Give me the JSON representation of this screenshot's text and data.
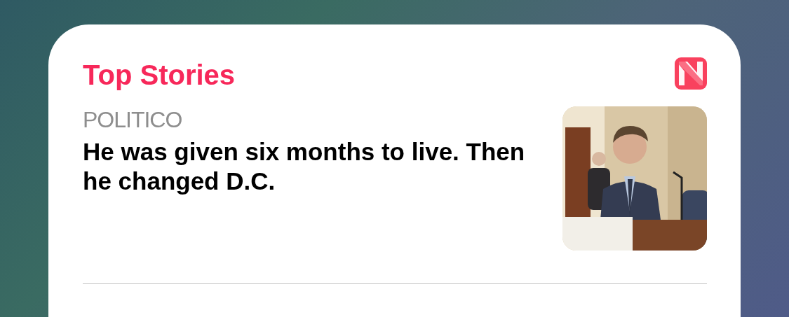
{
  "widget": {
    "title": "Top Stories",
    "story": {
      "source": "POLITICO",
      "headline": "He was given six months to live. Then he changed D.C."
    }
  }
}
